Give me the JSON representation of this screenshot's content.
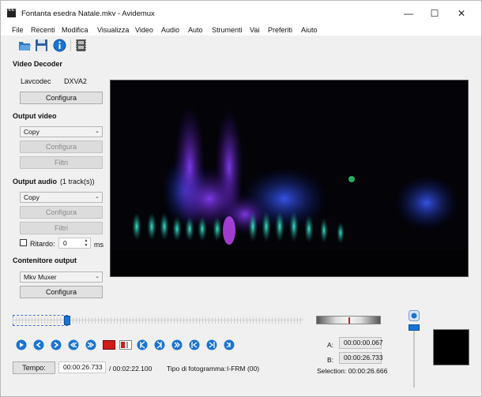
{
  "window": {
    "title": "Fontanta esedra Natale.mkv - Avidemux",
    "minimize_glyph": "—",
    "maximize_glyph": "☐",
    "close_glyph": "✕"
  },
  "menu": [
    "File",
    "Recenti",
    "Modifica",
    "Visualizza",
    "Video",
    "Audio",
    "Auto",
    "Strumenti",
    "Vai",
    "Preferiti",
    "Aiuto"
  ],
  "toolbar": {
    "icons": [
      "open-folder-icon",
      "save-disk-icon",
      "info-icon",
      "film-properties-icon"
    ]
  },
  "video_decoder": {
    "heading": "Video Decoder",
    "decoder_name": "Lavcodec",
    "decoder_accel": "DXVA2",
    "configure_label": "Configura"
  },
  "output_video": {
    "heading": "Output video",
    "codec": "Copy",
    "configure_label": "Configura",
    "filters_label": "Filtri"
  },
  "output_audio": {
    "heading": "Output audio",
    "tracks": "(1 track(s))",
    "codec": "Copy",
    "configure_label": "Configura",
    "filters_label": "Filtri",
    "delay_label": "Ritardo:",
    "delay_value": "0",
    "delay_unit": "ms"
  },
  "output_container": {
    "heading": "Contenitore output",
    "muxer": "Mkv Muxer",
    "configure_label": "Configura"
  },
  "navigation": {
    "controls": [
      "play-icon",
      "previous-frame-icon",
      "next-frame-icon",
      "previous-keyframe-icon",
      "next-keyframe-icon",
      "record-icon",
      "set-marker-a-icon",
      "set-marker-b-icon",
      "previous-black-frame-icon",
      "next-black-frame-icon",
      "go-to-start-icon",
      "go-to-end-icon"
    ],
    "time_button_label": "Tempo:",
    "current_time": "00:00:26.733",
    "total_time": "/ 00:02:22.100",
    "frame_type_label": "Tipo di fotogramma:",
    "frame_type_value": "I-FRM (00)",
    "position_fraction": 0.188
  },
  "selection": {
    "a_label": "A:",
    "a_value": "00:00:00.067",
    "b_label": "B:",
    "b_value": "00:00:26.733",
    "selection_text": "Selection: 00:00:26.666"
  },
  "colors": {
    "accent_blue": "#1b73d3",
    "record_red": "#d11a1a",
    "background": "#f0f0f0"
  }
}
